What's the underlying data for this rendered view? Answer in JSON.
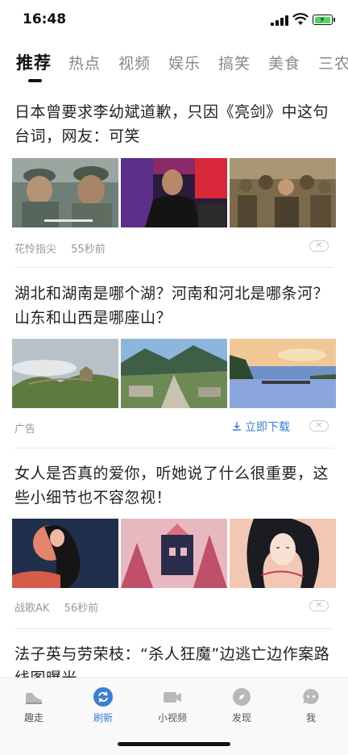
{
  "status_bar": {
    "time": "16:48"
  },
  "tabs": [
    {
      "label": "推荐"
    },
    {
      "label": "热点"
    },
    {
      "label": "视频"
    },
    {
      "label": "娱乐"
    },
    {
      "label": "搞笑"
    },
    {
      "label": "美食"
    },
    {
      "label": "三农"
    }
  ],
  "articles": [
    {
      "title": "日本曾要求李幼斌道歉，只因《亮剑》中这句台词，网友：可笑",
      "source": "花怜指尖",
      "time": "55秒前",
      "close": "✕"
    },
    {
      "title": "湖北和湖南是哪个湖？河南和河北是哪条河？山东和山西是哪座山？",
      "source": "广告",
      "action": "立即下载",
      "close": "✕"
    },
    {
      "title": "女人是否真的爱你，听她说了什么很重要，这些小细节也不容忽视！",
      "source": "战歌AK",
      "time": "56秒前",
      "close": "✕"
    },
    {
      "title": "法子英与劳荣枝：“杀人狂魔”边逃亡边作案路线图曝光"
    }
  ],
  "bottom_nav": [
    {
      "label": "趣走",
      "icon": "shoe-icon"
    },
    {
      "label": "刷新",
      "icon": "refresh-icon"
    },
    {
      "label": "小视频",
      "icon": "video-camera-icon"
    },
    {
      "label": "发现",
      "icon": "compass-icon"
    },
    {
      "label": "我",
      "icon": "chat-icon"
    }
  ],
  "colors": {
    "accent": "#3b7fd4",
    "text": "#222222",
    "muted": "#999999"
  }
}
